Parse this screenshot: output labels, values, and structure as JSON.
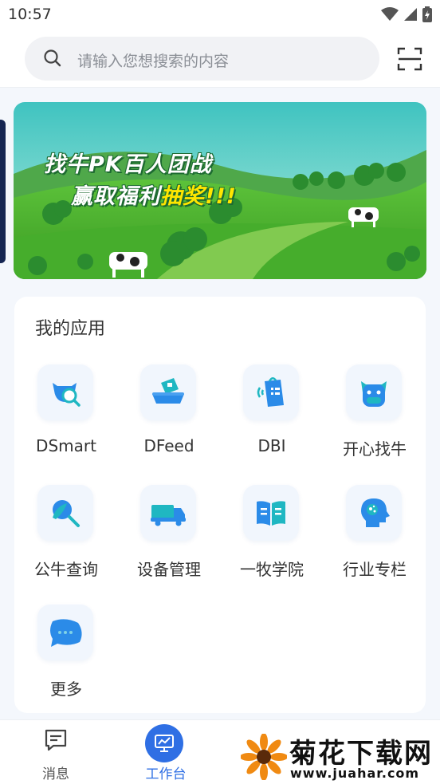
{
  "status": {
    "time": "10:57"
  },
  "search": {
    "placeholder": "请输入您想搜索的内容"
  },
  "banner": {
    "line1": "找牛PK百人团战",
    "line2_main": "赢取福利",
    "line2_highlight": "抽奖!!!"
  },
  "apps_section": {
    "title": "我的应用",
    "items": [
      {
        "label": "DSmart",
        "icon": "cow-search-icon"
      },
      {
        "label": "DFeed",
        "icon": "feed-trough-icon"
      },
      {
        "label": "DBI",
        "icon": "report-bag-icon"
      },
      {
        "label": "开心找牛",
        "icon": "cow-face-icon"
      },
      {
        "label": "公牛查询",
        "icon": "bull-search-icon"
      },
      {
        "label": "设备管理",
        "icon": "truck-icon"
      },
      {
        "label": "一牧学院",
        "icon": "open-book-icon"
      },
      {
        "label": "行业专栏",
        "icon": "head-idea-icon"
      },
      {
        "label": "更多",
        "icon": "chat-bubble-more-icon"
      }
    ]
  },
  "tabs": [
    {
      "label": "消息",
      "icon": "message-icon",
      "active": false
    },
    {
      "label": "工作台",
      "icon": "workbench-chart-icon",
      "active": true
    }
  ],
  "watermark": {
    "title": "菊花下载网",
    "url": "www.juahar.com"
  },
  "colors": {
    "accent": "#2f6fe4",
    "icon_blue": "#2b8be8",
    "icon_teal": "#1fb7c2",
    "card_bg": "#ffffff",
    "page_bg": "#f4f7fc"
  }
}
